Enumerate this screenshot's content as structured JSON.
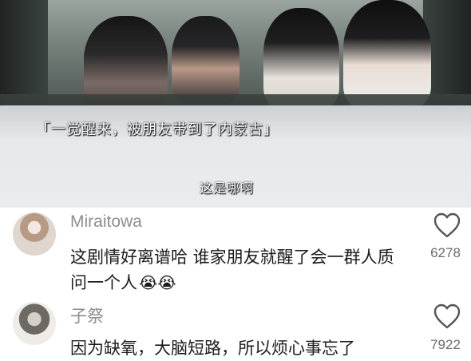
{
  "video": {
    "caption_top": "「一觉醒来，被朋友带到了内蒙古」",
    "caption_bottom": "这是哪啊"
  },
  "comments": [
    {
      "username": "Miraitowa",
      "text": "这剧情好离谱哈 谁家朋友就醒了会一群人质问一个人",
      "emoji": "😭😭",
      "likes": "6278",
      "like_icon": "heart-outline-icon"
    },
    {
      "username": "子祭",
      "text": "因为缺氧，大脑短路，所以烦心事忘了",
      "likes": "7922",
      "like_icon": "heart-outline-icon"
    }
  ],
  "colors": {
    "username": "#8e8e8e",
    "comment_text": "#1c1c1c",
    "like_count": "#6c6c6c"
  }
}
